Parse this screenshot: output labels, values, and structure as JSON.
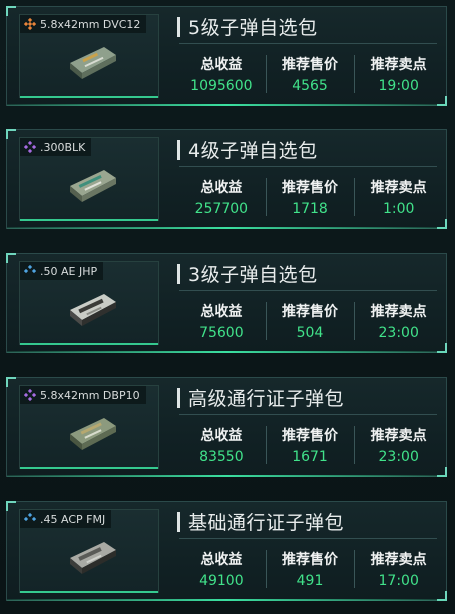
{
  "labels": {
    "total_income": "总收益",
    "recommended_price": "推荐售价",
    "recommended_time": "推荐卖点"
  },
  "colors": {
    "rarity_orange": "#e8843a",
    "rarity_purple": "#a56be0",
    "rarity_blue": "#4fa3e0",
    "value_green": "#41e28a",
    "accent_line": "#35c98f"
  },
  "packs": [
    {
      "ammo_name": "5.8x42mm DVC12",
      "rarity_icon": "orange-rarity-icon",
      "title": "5级子弹自选包",
      "total_income": "1095600",
      "recommended_price": "4565",
      "recommended_time": "19:00"
    },
    {
      "ammo_name": ".300BLK",
      "rarity_icon": "purple-rarity-icon",
      "title": "4级子弹自选包",
      "total_income": "257700",
      "recommended_price": "1718",
      "recommended_time": "1:00"
    },
    {
      "ammo_name": ".50 AE JHP",
      "rarity_icon": "blue-rarity-icon",
      "title": "3级子弹自选包",
      "total_income": "75600",
      "recommended_price": "504",
      "recommended_time": "23:00"
    },
    {
      "ammo_name": "5.8x42mm DBP10",
      "rarity_icon": "purple-rarity-icon",
      "title": "高级通行证子弹包",
      "total_income": "83550",
      "recommended_price": "1671",
      "recommended_time": "23:00"
    },
    {
      "ammo_name": ".45 ACP FMJ",
      "rarity_icon": "blue-rarity-icon",
      "title": "基础通行证子弹包",
      "total_income": "49100",
      "recommended_price": "491",
      "recommended_time": "17:00"
    }
  ]
}
